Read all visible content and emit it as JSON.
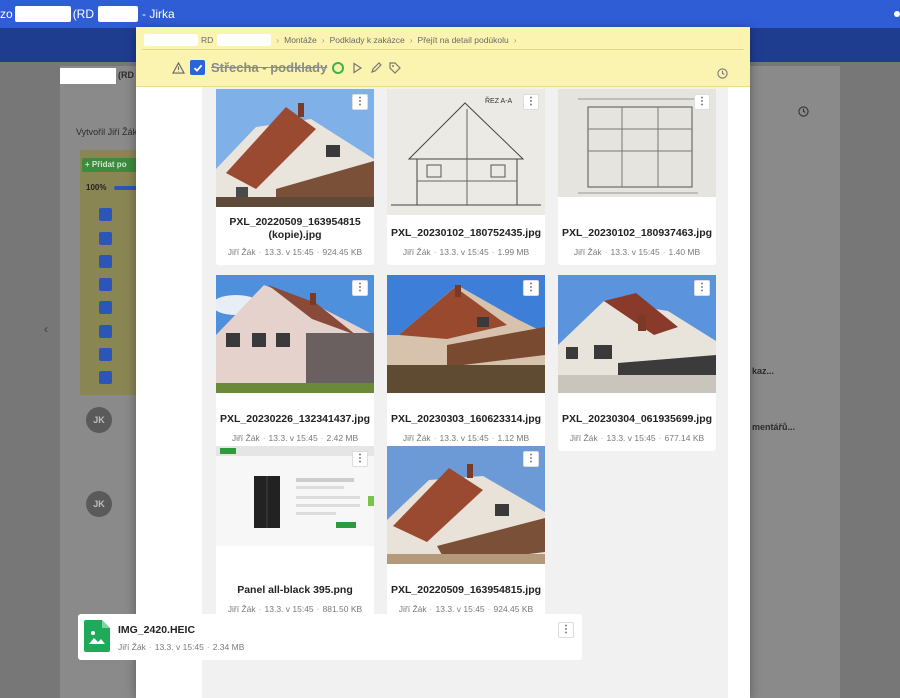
{
  "window": {
    "title_prefix": "zo",
    "title_mid": "(RD",
    "title_suffix": "- Jirka"
  },
  "background": {
    "heading_fragment": "(RD",
    "author_line": "Vytvořil Jiří Žák",
    "add_button": "Přidat po",
    "progress": "100%",
    "avatar_initials": "JK",
    "snippet_1": "kaz...",
    "snippet_2": "mentářů..."
  },
  "breadcrumb": {
    "project_fragment": "RD",
    "items": [
      "Montáže",
      "Podklady k zakázce",
      "Přejít na detail podúkolu"
    ]
  },
  "task": {
    "title": "Střecha - podklady",
    "completed": true
  },
  "files": [
    {
      "name": "PXL_20220509_163954815 (kopie).jpg",
      "author": "Jiří Žák",
      "date": "13.3. v 15:45",
      "size": "924.45 KB"
    },
    {
      "name": "PXL_20230102_180752435.jpg",
      "author": "Jiří Žák",
      "date": "13.3. v 15:45",
      "size": "1.99 MB"
    },
    {
      "name": "PXL_20230102_180937463.jpg",
      "author": "Jiří Žák",
      "date": "13.3. v 15:45",
      "size": "1.40 MB"
    },
    {
      "name": "PXL_20230226_132341437.jpg",
      "author": "Jiří Žák",
      "date": "13.3. v 15:45",
      "size": "2.42 MB"
    },
    {
      "name": "PXL_20230303_160623314.jpg",
      "author": "Jiří Žák",
      "date": "13.3. v 15:45",
      "size": "1.12 MB"
    },
    {
      "name": "PXL_20230304_061935699.jpg",
      "author": "Jiří Žák",
      "date": "13.3. v 15:45",
      "size": "677.14 KB"
    },
    {
      "name": "Panel all-black 395.png",
      "author": "Jiří Žák",
      "date": "13.3. v 15:45",
      "size": "881.50 KB"
    },
    {
      "name": "PXL_20220509_163954815.jpg",
      "author": "Jiří Žák",
      "date": "13.3. v 15:45",
      "size": "924.45 KB"
    }
  ],
  "file_list": [
    {
      "name": "IMG_2420.HEIC",
      "author": "Jiří Žák",
      "date": "13.3. v 15:45",
      "size": "2.34 MB"
    }
  ],
  "icons": {
    "kebab": "⋮",
    "separator": "›",
    "warning": "warning-icon",
    "play": "play-icon",
    "edit": "pencil-icon",
    "tag": "tag-icon",
    "history": "clock-icon",
    "image_file": "image-file-icon"
  },
  "colors": {
    "accent": "#2f5dd6",
    "header_yellow": "#fbf3b0",
    "success": "#3cb34a",
    "file_green": "#1faa59"
  }
}
